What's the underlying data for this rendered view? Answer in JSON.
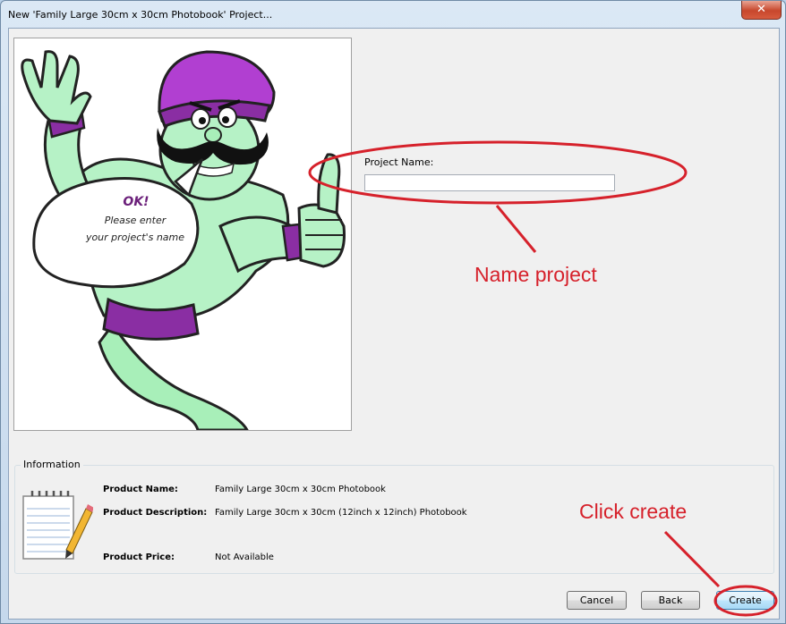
{
  "window": {
    "title": "New 'Family Large 30cm x 30cm Photobook' Project...",
    "close_glyph": "✕"
  },
  "illustration": {
    "bubble_title": "OK!",
    "bubble_line1": "Please enter",
    "bubble_line2": "your project's name"
  },
  "form": {
    "project_name_label": "Project Name:",
    "project_name_value": ""
  },
  "annotations": {
    "name_project": "Name project",
    "click_create": "Click create",
    "color": "#d6212b"
  },
  "information": {
    "legend": "Information",
    "icon": "notepad-pencil-icon",
    "product_name_label": "Product Name:",
    "product_name_value": "Family Large 30cm x 30cm Photobook",
    "product_description_label": "Product Description:",
    "product_description_value": "Family Large 30cm x 30cm (12inch x 12inch) Photobook",
    "product_price_label": "Product Price:",
    "product_price_value": "Not Available"
  },
  "buttons": {
    "cancel": "Cancel",
    "back": "Back",
    "create": "Create"
  }
}
